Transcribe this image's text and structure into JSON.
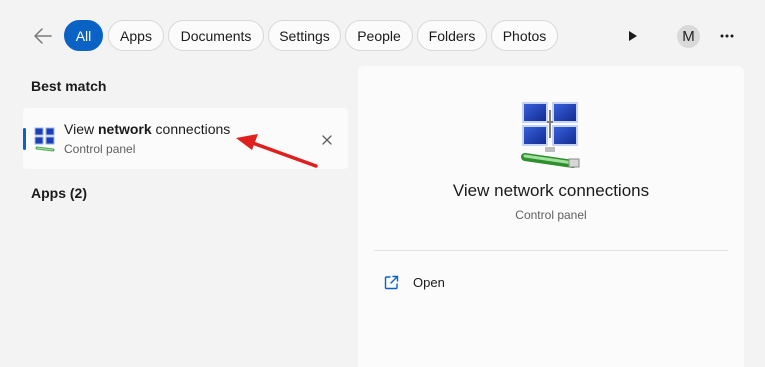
{
  "filters": {
    "all": "All",
    "apps": "Apps",
    "documents": "Documents",
    "settings": "Settings",
    "people": "People",
    "folders": "Folders",
    "photos": "Photos"
  },
  "account_initial": "M",
  "best_match": {
    "heading": "Best match",
    "item": {
      "title_prefix": "View ",
      "title_bold": "network",
      "title_suffix": " connections",
      "subtitle": "Control panel"
    }
  },
  "apps_heading": "Apps (2)",
  "detail": {
    "title": "View network connections",
    "subtitle": "Control panel",
    "open_label": "Open"
  },
  "colors": {
    "accent": "#0a63c4",
    "annotation_arrow": "#e0201e"
  },
  "icons": {
    "back": "back-arrow-icon",
    "play": "play-icon",
    "more": "more-options-icon",
    "result": "network-connections-icon",
    "remove": "close-icon",
    "open": "open-external-icon"
  }
}
